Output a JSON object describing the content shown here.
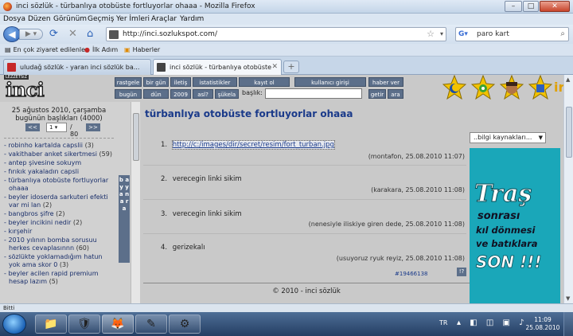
{
  "window": {
    "title": "inci sözlük - türbanlıya otobüste fortluyorlar ohaaa - Mozilla Firefox",
    "minimize": "–",
    "maximize": "□",
    "close": "✕"
  },
  "menu": [
    "Dosya",
    "Düzen",
    "Görünüm",
    "Geçmiş",
    "Yer İmleri",
    "Araçlar",
    "Yardım"
  ],
  "nav": {
    "url": "http://inci.sozlukspot.com/",
    "search_value": "paro kart"
  },
  "bookmarks": {
    "most_visited": "En çok ziyaret edilenler",
    "first_steps": "İlk Adım",
    "news": "Haberler"
  },
  "tabs": [
    {
      "label": "uludağ sözlük - yaran inci sözlük ba...",
      "active": false
    },
    {
      "label": "inci sözlük - türbanlıya otobüste fo...",
      "active": true
    }
  ],
  "site": {
    "logo_text": "inci sözlük",
    "logo_tag": "LEZZETSiZ",
    "nav_row1": [
      "rastgele",
      "bir gün",
      "iletiş",
      "istatistikler",
      "kayıt ol",
      "kullanıcı girişi",
      "haber ver"
    ],
    "nav_row2": [
      "bugün",
      "dün",
      "2009",
      "asl?",
      "şükela"
    ],
    "baslik_label": "başlık:",
    "getir": "getir",
    "ara": "ara"
  },
  "left": {
    "date_line1": "25 ağustos 2010, çarşamba",
    "date_line2": "bugünün başlıkları (4000)",
    "page_select": "1",
    "page_total": "/ 80",
    "prev": "<<",
    "next": ">>",
    "strip_text": "b a y y a n a r a",
    "topics": [
      {
        "title": "robinho kartalda capslii",
        "count": "(3)"
      },
      {
        "title": "vakithaber anket sikertmesi",
        "count": "(59)"
      },
      {
        "title": "antep şivesine sokuym",
        "count": ""
      },
      {
        "title": "fırıkık yakaladın capsli",
        "count": ""
      },
      {
        "title": "türbanlıya otobüste fortluyorlar ohaaa",
        "count": ""
      },
      {
        "title": "beyler idoserda sarkuteri efekti var mi lan",
        "count": "(2)"
      },
      {
        "title": "bangbros şifre",
        "count": "(2)"
      },
      {
        "title": "beyler incikini nedir",
        "count": "(2)"
      },
      {
        "title": "kırşehir",
        "count": ""
      },
      {
        "title": "2010 yılının bomba sorusuu herkes cevaplasınnn",
        "count": "(60)"
      },
      {
        "title": "sözlükte yoklamadığım hatun yok ama skor 0",
        "count": "(3)"
      },
      {
        "title": "beyler acilen rapid premium hesap lazım",
        "count": "(5)"
      }
    ]
  },
  "main": {
    "title": "türbanlıya otobüste fortluyorlar ohaaa",
    "entries": [
      {
        "num": "1.",
        "text": "http://c:/images/dir/secret/resim/fort_turban.jpg",
        "author": "(montafon, 25.08.2010 11:07)"
      },
      {
        "num": "2.",
        "text": "verecegin linki sikim",
        "author": "(karakara, 25.08.2010 11:08)"
      },
      {
        "num": "3.",
        "text": "verecegin linki sikim",
        "author": "(nenesiyle iliskiye giren dede, 25.08.2010 11:08)"
      },
      {
        "num": "4.",
        "text": "gerizekalı",
        "author": "(usuyoruz ryuk reyiz, 25.08.2010 11:08)"
      }
    ],
    "entry_id": "#19466138",
    "entry_button": "!?",
    "footer": "© 2010 - inci sözlük",
    "info_select": "..bilgi kaynakları..."
  },
  "ad": {
    "line1": "Traş",
    "line2": "sonrası",
    "line3": "kıl dönmesi",
    "line4": "ve batıklara",
    "line5": "SON !!!"
  },
  "status": "Bitti",
  "taskbar": {
    "lang": "TR",
    "time": "11:09",
    "date": "25.08.2010"
  }
}
